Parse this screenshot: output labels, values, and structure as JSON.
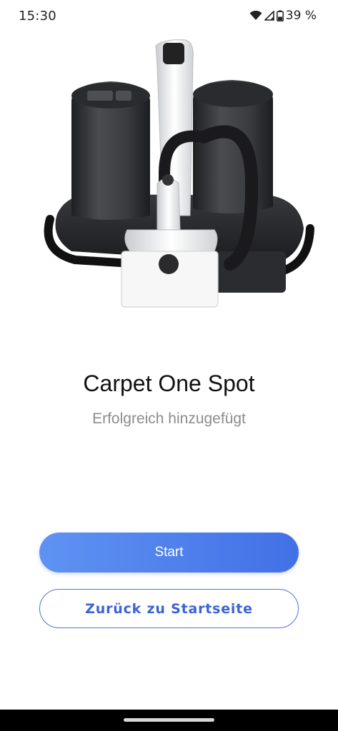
{
  "status_bar": {
    "time": "15:30",
    "battery_text": "39 %",
    "icons": [
      "wifi-icon",
      "signal-icon",
      "battery-icon"
    ]
  },
  "product": {
    "image": "carpet-cleaner-image",
    "name": "Carpet One Spot",
    "status": "Erfolgreich hinzugefügt"
  },
  "actions": {
    "start_label": "Start",
    "home_label": "Zurück zu Startseite"
  },
  "colors": {
    "primary_gradient_start": "#5f93f2",
    "primary_gradient_end": "#4270e6",
    "outline_text": "#3b63d8"
  }
}
